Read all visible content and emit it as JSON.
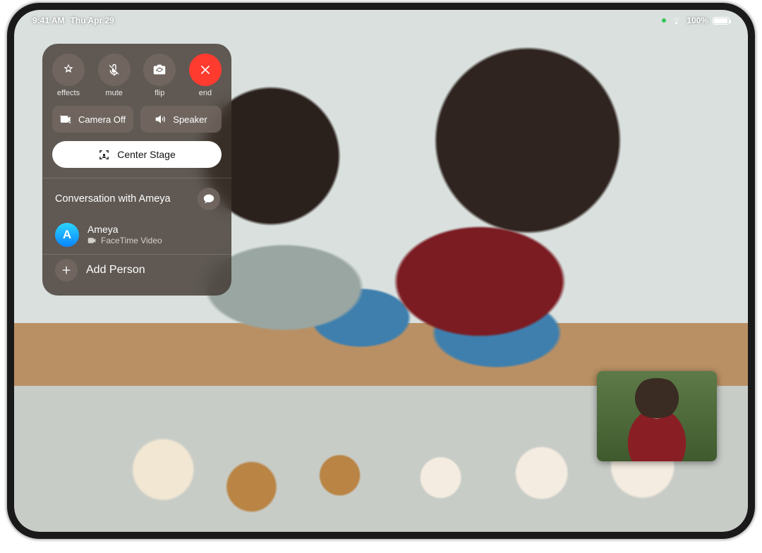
{
  "status": {
    "time": "9:41 AM",
    "date": "Thu Apr 29",
    "battery_pct": "100%"
  },
  "controls": {
    "effects": "effects",
    "mute": "mute",
    "flip": "flip",
    "end": "end",
    "camera_off": "Camera Off",
    "speaker": "Speaker",
    "center_stage": "Center Stage"
  },
  "conversation": {
    "title": "Conversation with Ameya",
    "participant": {
      "initial": "A",
      "name": "Ameya",
      "subtitle": "FaceTime Video"
    },
    "add_person": "Add Person"
  },
  "colors": {
    "end_call": "#ff3b30",
    "accent_blue": "#0a84ff"
  }
}
